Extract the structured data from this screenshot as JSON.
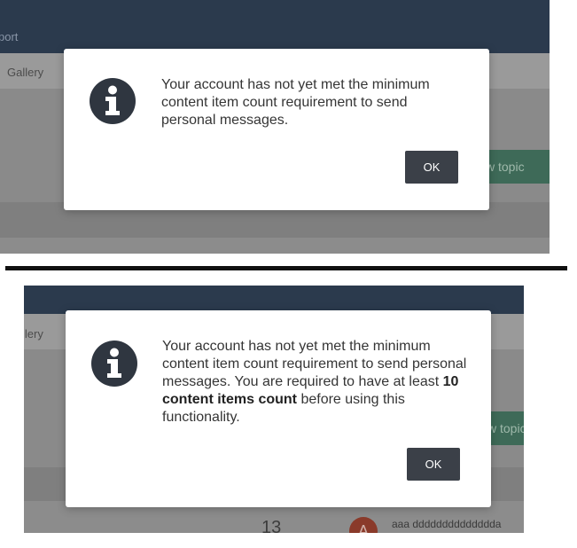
{
  "top_screenshot": {
    "nav_partial": "port",
    "subnav_partial": "Gallery",
    "new_topic_partial": "w topic",
    "dialog": {
      "message": "Your account has not yet met the minimum content item count requirement to send personal messages.",
      "ok_label": "OK"
    }
  },
  "bottom_screenshot": {
    "subnav_partial": "llery",
    "new_topic_partial": "w topic",
    "dialog": {
      "message_part1": "Your account has not yet met the minimum content item count requirement to send personal messages. You are required to have at least ",
      "message_bold": "10 content items count",
      "message_part2": " before using this functionality.",
      "ok_label": "OK"
    },
    "row": {
      "count": "13",
      "avatar_letter": "A",
      "poster_name": "aaa dddddddddddddda"
    }
  },
  "colors": {
    "navbar": "#2b3a4d",
    "overlay_gray": "#8a8a8a",
    "ok_button": "#3b4048",
    "new_topic": "#3e6a58"
  },
  "icons": [
    "info-circle-icon"
  ]
}
